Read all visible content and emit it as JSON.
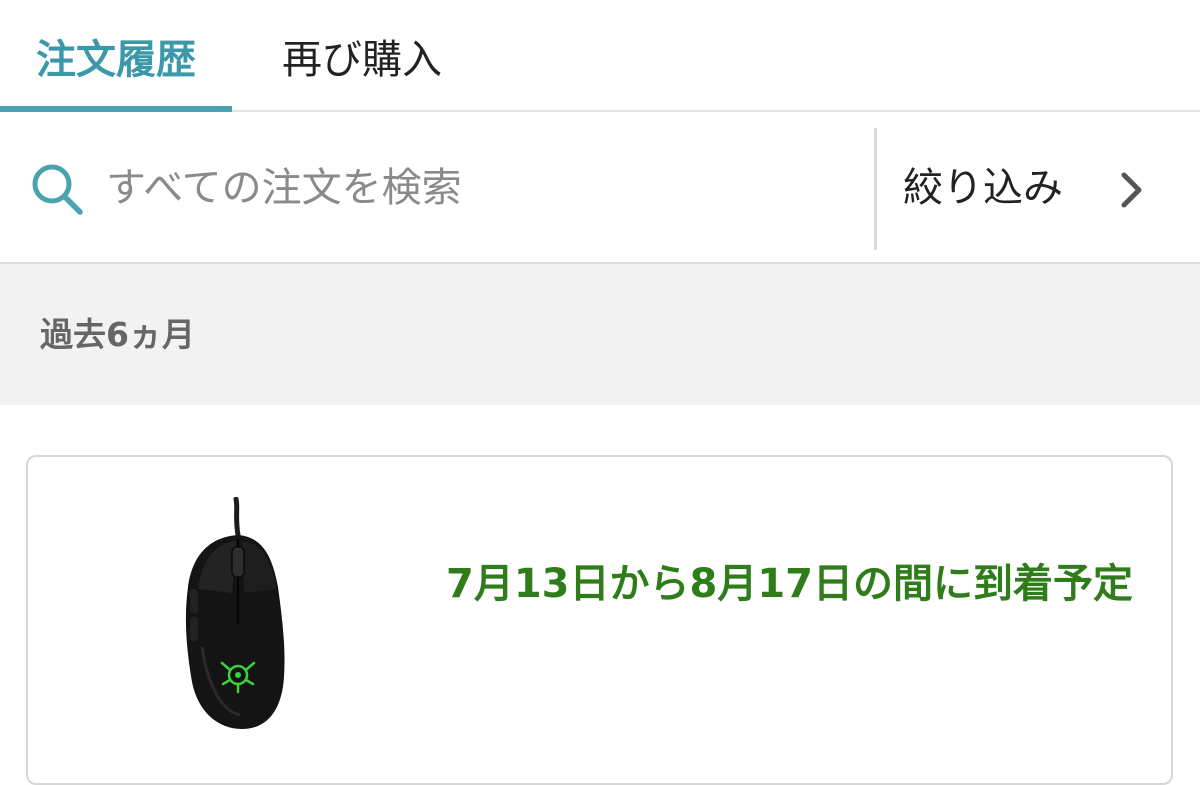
{
  "tabs": [
    {
      "label": "注文履歴",
      "active": true
    },
    {
      "label": "再び購入",
      "active": false
    }
  ],
  "search": {
    "placeholder": "すべての注文を検索",
    "value": ""
  },
  "filter": {
    "label": "絞り込み"
  },
  "section": {
    "title": "過去6ヵ月"
  },
  "order": {
    "delivery_estimate": "7月13日から8月17日の間に到着予定",
    "product_image": "black-gaming-mouse"
  },
  "colors": {
    "accent": "#4aa3b1",
    "delivery_green": "#2f7d1a",
    "section_bg": "#f2f2f2"
  }
}
